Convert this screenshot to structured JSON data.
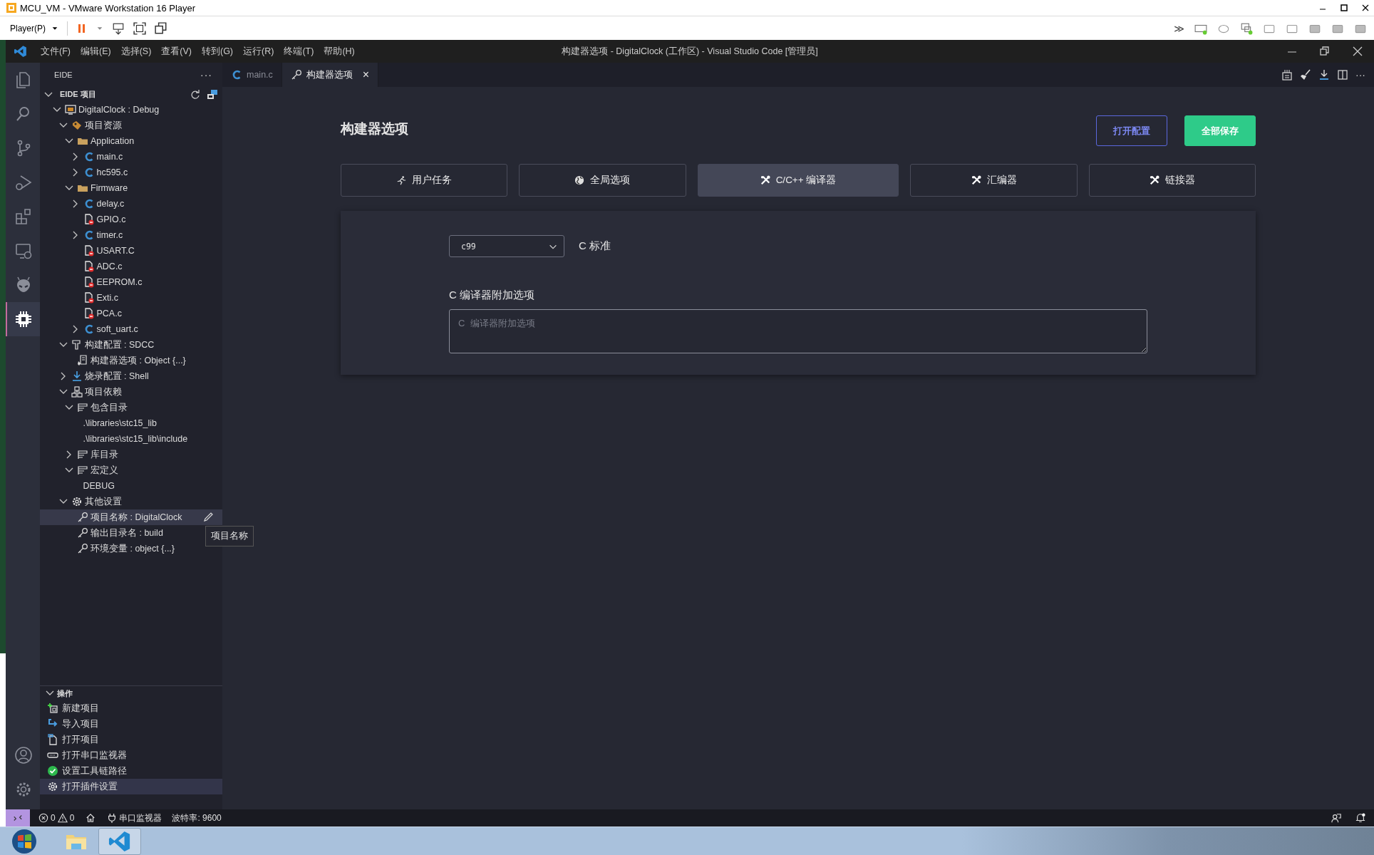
{
  "vmware": {
    "title": "MCU_VM - VMware Workstation 16 Player",
    "player_menu": "Player(P)",
    "overflow": "≫"
  },
  "vscode": {
    "menu": [
      "文件(F)",
      "编辑(E)",
      "选择(S)",
      "查看(V)",
      "转到(G)",
      "运行(R)",
      "终端(T)",
      "帮助(H)"
    ],
    "title": "构建器选项 - DigitalClock (工作区) - Visual Studio Code [管理员]"
  },
  "activity_bar": {
    "items": [
      {
        "selected": false
      },
      {
        "selected": false
      },
      {
        "selected": false
      },
      {
        "selected": false
      },
      {
        "selected": false
      },
      {
        "selected": false
      },
      {
        "selected": false
      },
      {
        "selected": true
      }
    ],
    "bottom": [
      {
        "selected": false
      },
      {
        "selected": false
      }
    ]
  },
  "sidebar": {
    "title": "EIDE",
    "more": "···",
    "section": "EIDE 项目",
    "tree": [
      {
        "label": "DigitalClock : Debug",
        "kind": "project",
        "expanded": true,
        "selected": false,
        "children": [
          {
            "label": "项目资源",
            "kind": "resources",
            "expanded": true,
            "selected": false,
            "children": [
              {
                "label": "Application",
                "kind": "folder",
                "expanded": true,
                "selected": false,
                "children": [
                  {
                    "label": "main.c",
                    "kind": "c-file",
                    "expanded": false,
                    "selected": false
                  },
                  {
                    "label": "hc595.c",
                    "kind": "c-file",
                    "expanded": false,
                    "selected": false
                  }
                ]
              },
              {
                "label": "Firmware",
                "kind": "folder",
                "expanded": true,
                "selected": false,
                "children": [
                  {
                    "label": "delay.c",
                    "kind": "c-file",
                    "expanded": false,
                    "selected": false
                  },
                  {
                    "label": "GPIO.c",
                    "kind": "excluded-file",
                    "selected": false
                  },
                  {
                    "label": "timer.c",
                    "kind": "c-file",
                    "expanded": false,
                    "selected": false
                  },
                  {
                    "label": "USART.C",
                    "kind": "excluded-file",
                    "selected": false
                  },
                  {
                    "label": "ADC.c",
                    "kind": "excluded-file",
                    "selected": false
                  },
                  {
                    "label": "EEPROM.c",
                    "kind": "excluded-file",
                    "selected": false
                  },
                  {
                    "label": "Exti.c",
                    "kind": "excluded-file",
                    "selected": false
                  },
                  {
                    "label": "PCA.c",
                    "kind": "excluded-file",
                    "selected": false
                  },
                  {
                    "label": "soft_uart.c",
                    "kind": "c-file",
                    "expanded": false,
                    "selected": false
                  }
                ]
              }
            ]
          },
          {
            "label": "构建配置 : SDCC",
            "kind": "hammer",
            "expanded": true,
            "selected": false,
            "children": [
              {
                "label": "构建器选项 : Object {...}",
                "kind": "options",
                "selected": false
              }
            ]
          },
          {
            "label": "烧录配置 : Shell",
            "kind": "download",
            "expanded": false,
            "selected": false
          },
          {
            "label": "项目依赖",
            "kind": "deps",
            "expanded": true,
            "selected": false,
            "children": [
              {
                "label": "包含目录",
                "kind": "list",
                "expanded": true,
                "selected": false,
                "children": [
                  {
                    "label": ".\\libraries\\stc15_lib",
                    "kind": "path",
                    "selected": false
                  },
                  {
                    "label": ".\\libraries\\stc15_lib\\include",
                    "kind": "path",
                    "selected": false
                  }
                ]
              },
              {
                "label": "库目录",
                "kind": "list",
                "expanded": false,
                "selected": false
              },
              {
                "label": "宏定义",
                "kind": "list",
                "expanded": true,
                "selected": false,
                "children": [
                  {
                    "label": "DEBUG",
                    "kind": "path",
                    "selected": false
                  }
                ]
              }
            ]
          },
          {
            "label": "其他设置",
            "kind": "gear",
            "expanded": true,
            "selected": false,
            "children": [
              {
                "label": "项目名称 : DigitalClock",
                "kind": "key",
                "selected": true
              },
              {
                "label": "输出目录名 : build",
                "kind": "key",
                "selected": false
              },
              {
                "label": "环境变量 : object {...}",
                "kind": "key",
                "selected": false
              }
            ]
          }
        ]
      }
    ],
    "actions_title": "操作",
    "actions": [
      {
        "label": "新建项目",
        "kind": "new",
        "selected": false
      },
      {
        "label": "导入项目",
        "kind": "import",
        "selected": false
      },
      {
        "label": "打开项目",
        "kind": "open",
        "selected": false
      },
      {
        "label": "打开串口监视器",
        "kind": "serial",
        "selected": false
      },
      {
        "label": "设置工具链路径",
        "kind": "check",
        "selected": false
      },
      {
        "label": "打开插件设置",
        "kind": "gear",
        "selected": true
      }
    ]
  },
  "tooltip": "项目名称",
  "tabs": [
    {
      "label": "main.c",
      "kind": "c-file",
      "selected": false
    },
    {
      "label": "构建器选项",
      "kind": "options",
      "selected": true,
      "close": "×"
    }
  ],
  "editor_more": "···",
  "page": {
    "title": "构建器选项",
    "buttons": [
      {
        "label": "打开配置",
        "kind": "outline"
      },
      {
        "label": "全部保存",
        "kind": "primary"
      }
    ],
    "tabs": [
      {
        "label": "用户任务",
        "kind": "run",
        "selected": false
      },
      {
        "label": "全局选项",
        "kind": "globe",
        "selected": false
      },
      {
        "label": "C/C++ 编译器",
        "kind": "tools",
        "selected": true
      },
      {
        "label": "汇编器",
        "kind": "tools",
        "selected": false
      },
      {
        "label": "链接器",
        "kind": "tools",
        "selected": false
      }
    ],
    "standard": {
      "value": "c99",
      "label": "C 标准"
    },
    "extra": {
      "label": "C 编译器附加选项",
      "placeholder": "C  编译器附加选项"
    }
  },
  "status_bar": {
    "errors": "0",
    "warnings": "0",
    "serial": "串口监视器",
    "baud": "波特率: 9600"
  }
}
